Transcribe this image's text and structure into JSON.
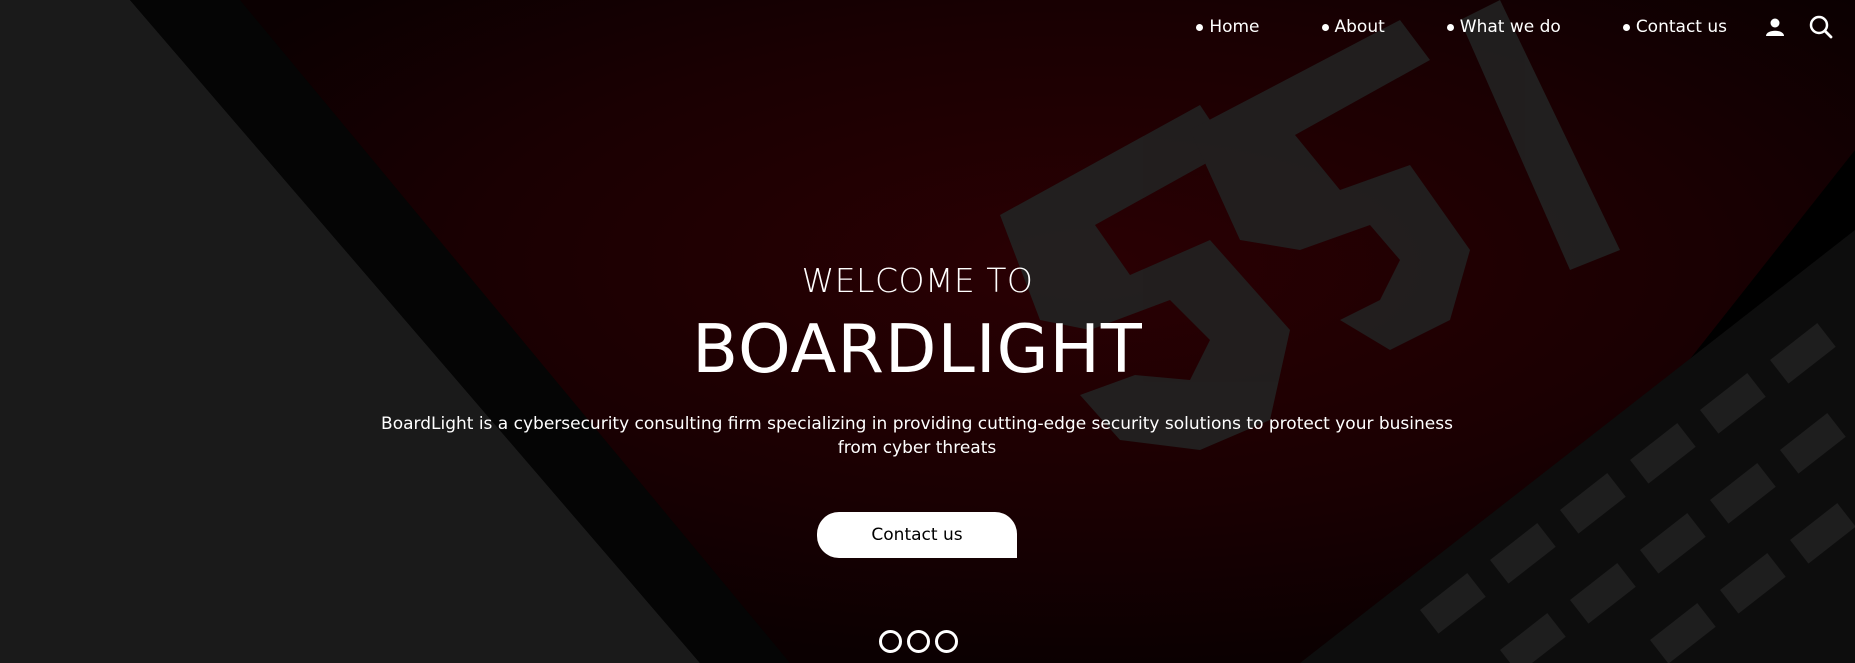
{
  "nav": {
    "items": [
      {
        "label": "Home"
      },
      {
        "label": "About"
      },
      {
        "label": "What we do"
      },
      {
        "label": "Contact us"
      }
    ],
    "icons": [
      "user-icon",
      "search-icon"
    ]
  },
  "hero": {
    "welcome": "WELCOME TO",
    "brand": "BOARDLIGHT",
    "description": "BoardLight is a cybersecurity consulting firm specializing in providing cutting-edge security solutions to protect your business from cyber threats",
    "cta_label": "Contact us",
    "slide_count": 3
  },
  "colors": {
    "accent_red": "#2a0003",
    "text": "#ffffff",
    "button_bg": "#ffffff",
    "button_text": "#000000"
  }
}
